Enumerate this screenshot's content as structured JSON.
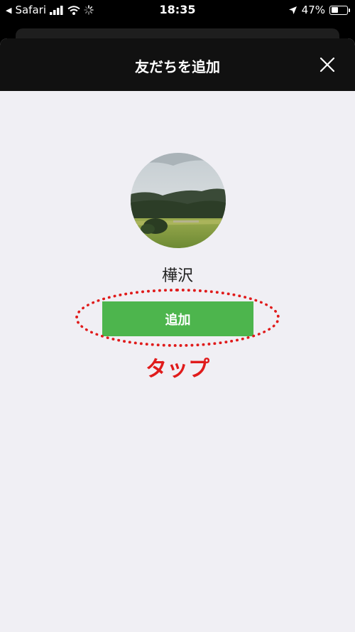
{
  "status_bar": {
    "back_app": "Safari",
    "time": "18:35",
    "battery_percent": "47%",
    "battery_level": 0.47
  },
  "modal": {
    "title": "友だちを追加",
    "close_icon": "close-icon"
  },
  "profile": {
    "name": "樺沢",
    "add_button_label": "追加"
  },
  "annotation": {
    "label": "タップ",
    "color": "#e01b1b"
  },
  "colors": {
    "header_bg": "#111111",
    "content_bg": "#f0eff4",
    "add_button": "#4db54d"
  }
}
